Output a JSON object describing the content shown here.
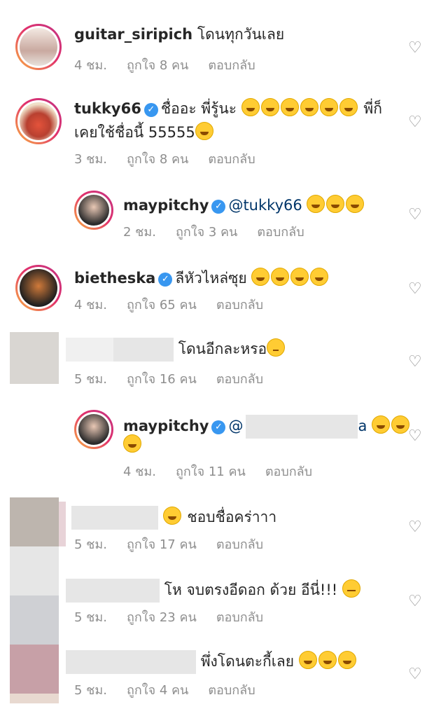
{
  "comments": [
    {
      "username": "guitar_siripich",
      "text": "โดนทุกวันเลย",
      "time": "4 ชม.",
      "likes": "ถูกใจ 8 คน",
      "reply": "ตอบกลับ",
      "emojis": 0
    },
    {
      "username": "tukky66",
      "text": "ชื่ออะ พี่รู้นะ",
      "emojis_after": 6,
      "text2": "พี่ก็",
      "line2": "เคยใช้ชื่อนี้ 55555",
      "line2_emojis": 1,
      "time": "3 ชม.",
      "likes": "ถูกใจ 8 คน",
      "reply": "ตอบกลับ"
    },
    {
      "username": "maypitchy",
      "text": "@tukky66",
      "emojis": 3,
      "time": "2 ชม.",
      "likes": "ถูกใจ 3 คน",
      "reply": "ตอบกลับ"
    },
    {
      "username": "bietheska",
      "text": "ลีหัวไหล่ซุย",
      "emojis": 4,
      "time": "4 ชม.",
      "likes": "ถูกใจ 65 คน",
      "reply": "ตอบกลับ"
    },
    {
      "username": "",
      "text": "โดนอีกละหรอ",
      "emojis": 1,
      "time": "5 ชม.",
      "likes": "ถูกใจ 16 คน",
      "reply": "ตอบกลับ"
    },
    {
      "username": "maypitchy",
      "text_prefix": "@",
      "text_suffix": "a",
      "emojis": 2,
      "line2_emojis": 1,
      "time": "4 ชม.",
      "likes": "ถูกใจ 11 คน",
      "reply": "ตอบกลับ"
    },
    {
      "username": "",
      "text": "ชอบชื่อคร่าาา",
      "emojis_before": 1,
      "time": "5 ชม.",
      "likes": "ถูกใจ 17 คน",
      "reply": "ตอบกลับ"
    },
    {
      "username": "",
      "text": "โห จบตรงอีดอก ด้วย อีนี่!!!",
      "emojis": 1,
      "time": "5 ชม.",
      "likes": "ถูกใจ 23 คน",
      "reply": "ตอบกลับ"
    },
    {
      "username": "",
      "text": "พึ่งโดนตะกี้เลย",
      "emojis": 3,
      "time": "5 ชม.",
      "likes": "ถูกใจ 4 คน",
      "reply": "ตอบกลับ"
    }
  ],
  "icons": {
    "heart": "heart-outline-icon",
    "verified": "verified-badge-icon"
  },
  "colors": {
    "accent": "#e1306c",
    "verified": "#3897f0",
    "meta": "#8e8e8e"
  }
}
